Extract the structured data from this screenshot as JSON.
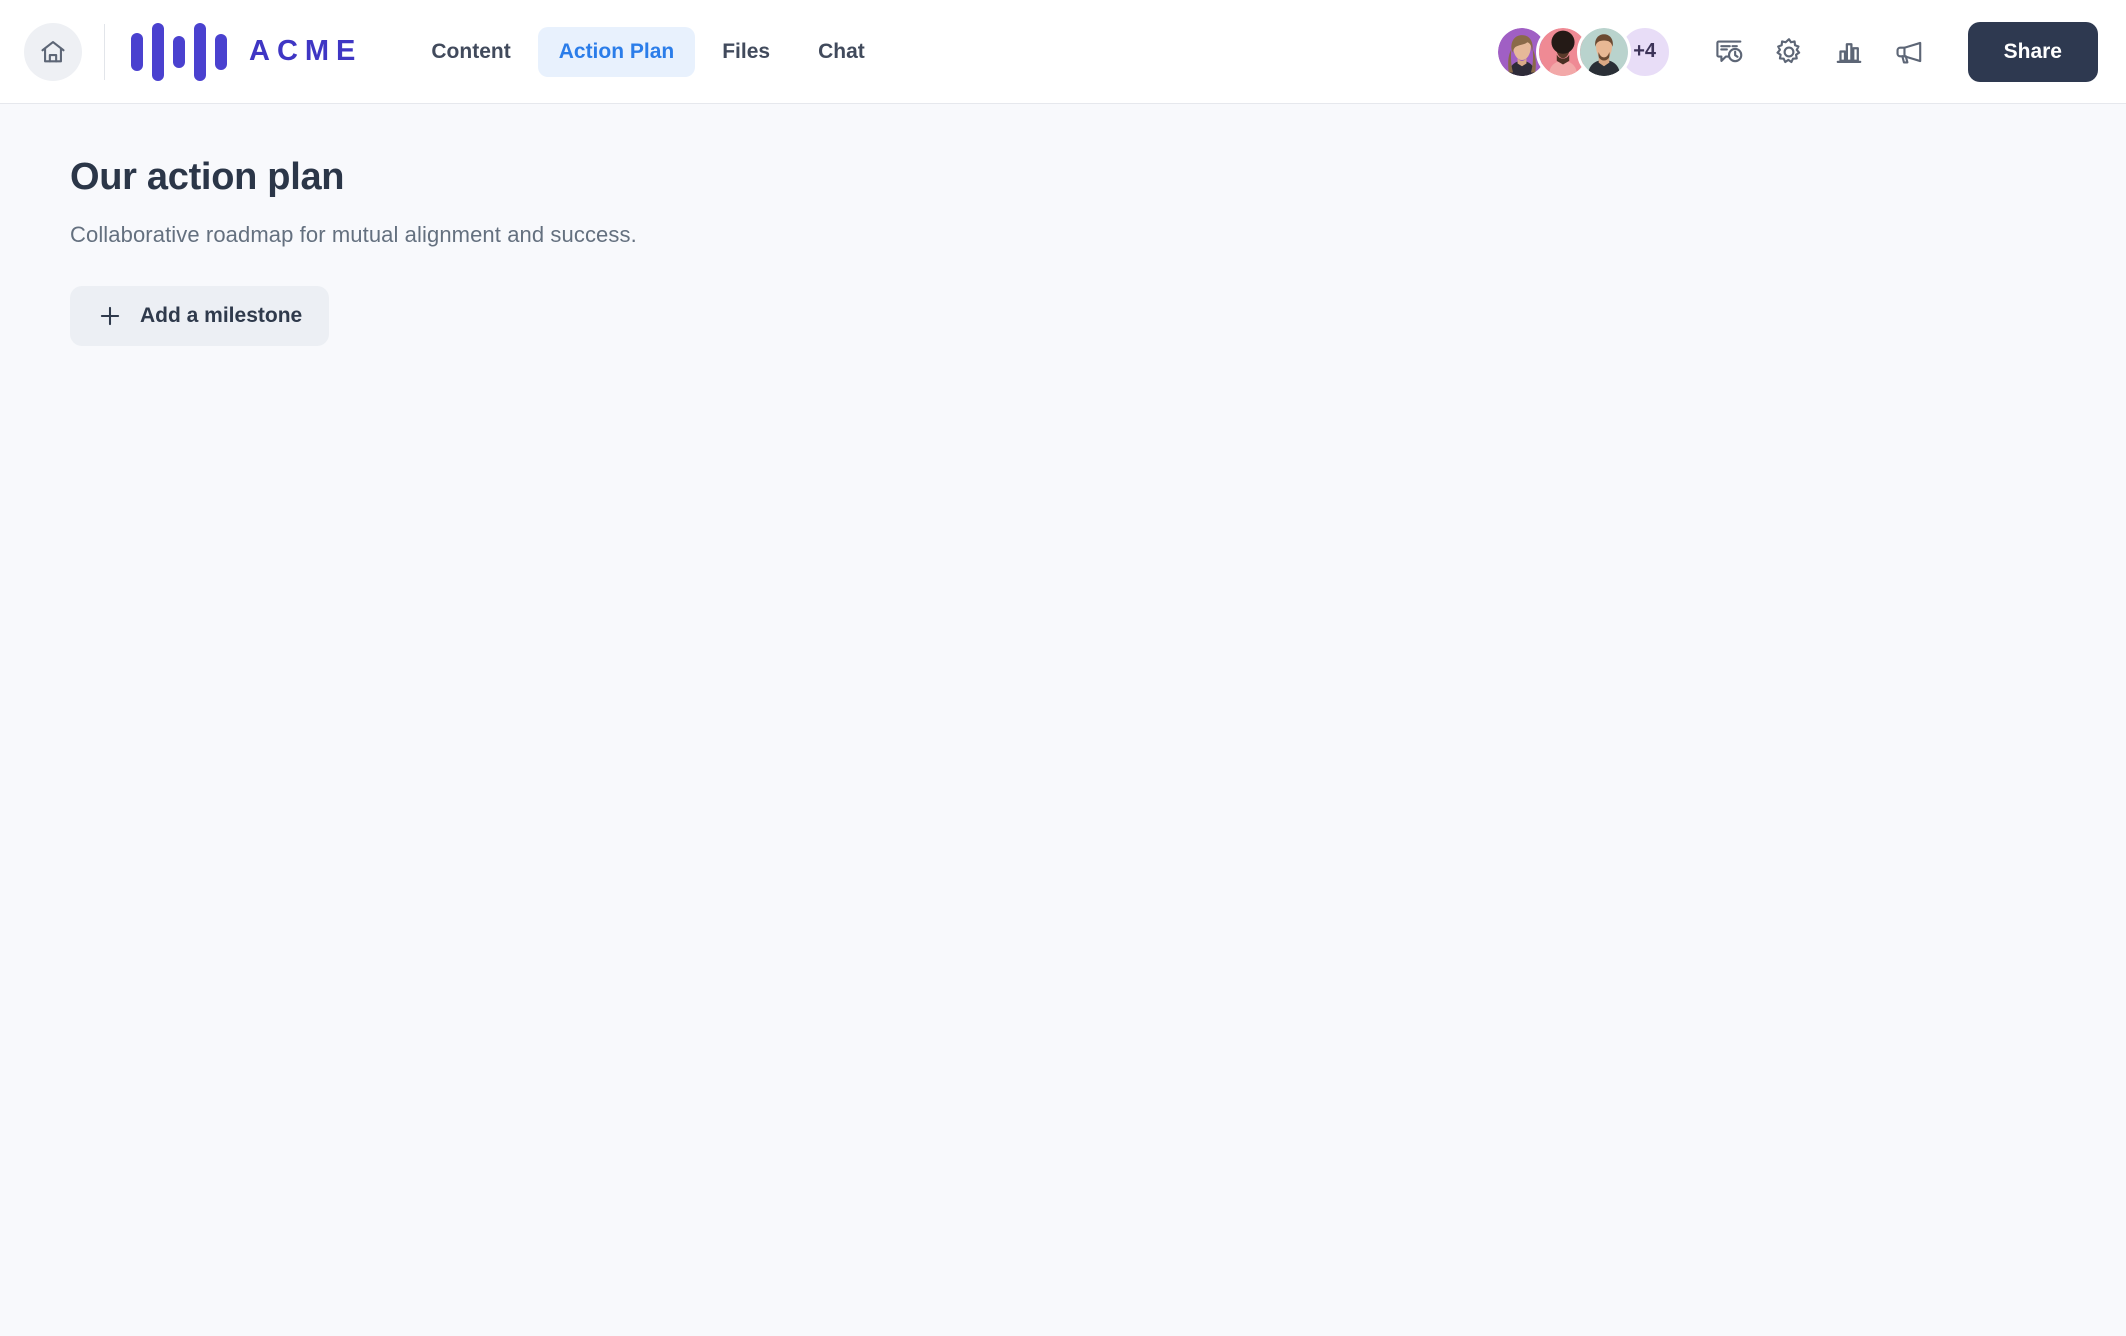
{
  "header": {
    "home_icon": "home-icon",
    "brand": {
      "name": "ACME",
      "logo_icon": "acme-bars-logo",
      "bar_color": "#4a41cf",
      "word_color": "#3f36c4"
    },
    "nav": [
      {
        "label": "Content",
        "active": false
      },
      {
        "label": "Action Plan",
        "active": true
      },
      {
        "label": "Files",
        "active": false
      },
      {
        "label": "Chat",
        "active": false
      }
    ],
    "active_tab_color": "#2b7de9",
    "active_tab_bg": "#e8f1fd",
    "avatars": {
      "people": [
        {
          "name": "avatar-person-1",
          "bg": "#a濃"
        },
        {
          "name": "avatar-person-2",
          "bg": "#ef8a94"
        },
        {
          "name": "avatar-person-3",
          "bg": "#b9d3cd"
        }
      ],
      "overflow_label": "+4",
      "overflow_bg": "#e8ddf7"
    },
    "icons": [
      {
        "name": "activity-history-icon",
        "title": "Activity"
      },
      {
        "name": "gear-icon",
        "title": "Settings"
      },
      {
        "name": "bar-chart-icon",
        "title": "Analytics"
      },
      {
        "name": "megaphone-icon",
        "title": "Announcements"
      }
    ],
    "share_label": "Share",
    "share_bg": "#2e3950"
  },
  "main": {
    "title": "Our action plan",
    "subtitle": "Collaborative roadmap for mutual alignment and success.",
    "add_milestone_label": "Add a milestone",
    "add_icon": "plus-icon",
    "background": "#f8f9fc"
  }
}
